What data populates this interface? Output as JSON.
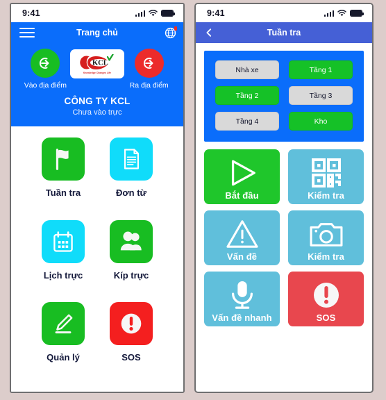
{
  "theme": {
    "page_background": "#dccdcb",
    "brand_blue": "#0a6dfb",
    "nav_indigo": "#4560d6",
    "green": "#18bd22",
    "cyan_bright": "#10dcfa",
    "cyan_soft": "#60bfdb",
    "red": "#ec2b2b",
    "tile_red": "#e8474e",
    "zone_gray": "#d9d9d9",
    "text_dark": "#13183a"
  },
  "left_phone": {
    "status_bar": {
      "time": "9:41",
      "signal_icon": "cellular-signal-icon",
      "wifi_icon": "wifi-icon",
      "battery_icon": "battery-full-icon"
    },
    "header": {
      "menu_icon": "hamburger-menu-icon",
      "title": "Trang chủ",
      "language_icon": "globe-icon",
      "punch_in": {
        "label": "Vào địa điểm",
        "icon": "login-arrow-icon",
        "color": "#18bd22"
      },
      "punch_out": {
        "label": "Ra địa điểm",
        "icon": "logout-arrow-icon",
        "color": "#ec2b2b"
      },
      "logo": {
        "brand": "KCL",
        "tagline": "Knowledge Changes Life",
        "icon": "kcl-logo"
      },
      "company_name": "CÔNG TY KCL",
      "shift_status": "Chưa vào trực"
    },
    "menu": [
      {
        "label": "Tuần tra",
        "icon": "flag-icon",
        "color": "#18bd22"
      },
      {
        "label": "Đơn từ",
        "icon": "document-icon",
        "color": "#10dcfa"
      },
      {
        "label": "Lịch trực",
        "icon": "calendar-icon",
        "color": "#10dcfa"
      },
      {
        "label": "Kíp trực",
        "icon": "people-icon",
        "color": "#18bd22"
      },
      {
        "label": "Quản lý",
        "icon": "pencil-icon",
        "color": "#18bd22"
      },
      {
        "label": "SOS",
        "icon": "alert-circle-icon",
        "color": "#f41f1f"
      }
    ]
  },
  "right_phone": {
    "status_bar": {
      "time": "9:41",
      "signal_icon": "cellular-signal-icon",
      "wifi_icon": "wifi-icon",
      "battery_icon": "battery-full-icon"
    },
    "header": {
      "back_icon": "chevron-left-icon",
      "title": "Tuần tra"
    },
    "zones": [
      {
        "label": "Nhà xe",
        "state": "inactive"
      },
      {
        "label": "Tầng 1",
        "state": "active"
      },
      {
        "label": "Tầng 2",
        "state": "active"
      },
      {
        "label": "Tầng 3",
        "state": "inactive"
      },
      {
        "label": "Tầng 4",
        "state": "inactive"
      },
      {
        "label": "Kho",
        "state": "active"
      }
    ],
    "actions": [
      {
        "label": "Bắt đầu",
        "icon": "play-icon",
        "style": "green"
      },
      {
        "label": "Kiểm tra",
        "icon": "qr-code-icon",
        "style": "cyan"
      },
      {
        "label": "Vấn đề",
        "icon": "warning-triangle-icon",
        "style": "cyan"
      },
      {
        "label": "Kiểm tra",
        "icon": "camera-icon",
        "style": "cyan"
      },
      {
        "label": "Vấn đề nhanh",
        "icon": "microphone-icon",
        "style": "cyan"
      },
      {
        "label": "SOS",
        "icon": "alert-circle-icon",
        "style": "red"
      }
    ]
  }
}
